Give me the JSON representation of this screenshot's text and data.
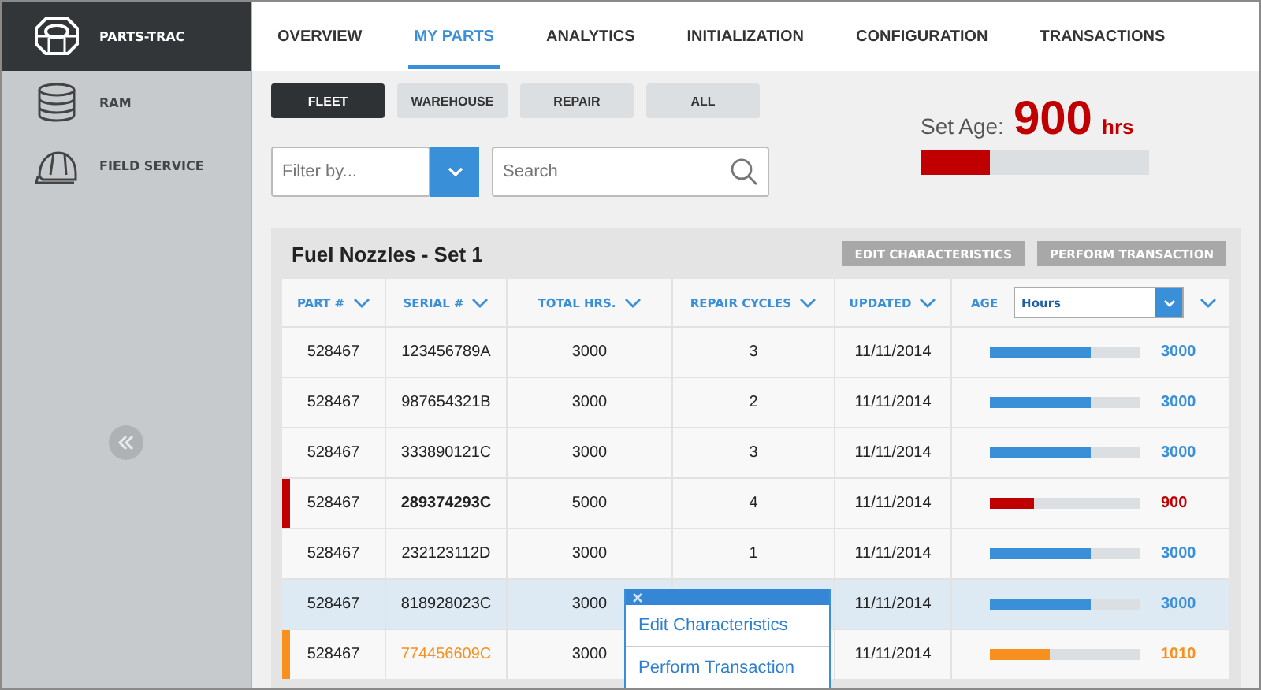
{
  "sidebar": {
    "items": [
      {
        "label": "PARTS-TRAC",
        "selected": true
      },
      {
        "label": "RAM",
        "selected": false
      },
      {
        "label": "FIELD SERVICE",
        "selected": false
      }
    ]
  },
  "tabs": [
    {
      "label": "OVERVIEW",
      "selected": false
    },
    {
      "label": "MY PARTS",
      "selected": true
    },
    {
      "label": "ANALYTICS",
      "selected": false
    },
    {
      "label": "INITIALIZATION",
      "selected": false
    },
    {
      "label": "CONFIGURATION",
      "selected": false
    },
    {
      "label": "TRANSACTIONS",
      "selected": false
    }
  ],
  "filters": [
    {
      "label": "FLEET",
      "selected": true
    },
    {
      "label": "WAREHOUSE",
      "selected": false
    },
    {
      "label": "REPAIR",
      "selected": false
    },
    {
      "label": "ALL",
      "selected": false
    }
  ],
  "filter_select": {
    "placeholder": "Filter by..."
  },
  "search": {
    "placeholder": "Search"
  },
  "set_age": {
    "label": "Set Age:",
    "value": "900",
    "unit": "hrs",
    "level": 0.3
  },
  "card": {
    "title": "Fuel Nozzles - Set 1",
    "actions": [
      "EDIT CHARACTERISTICS",
      "PERFORM TRANSACTION"
    ]
  },
  "table": {
    "columns": [
      "PART #",
      "SERIAL #",
      "TOTAL HRS.",
      "REPAIR CYCLES",
      "UPDATED",
      "AGE"
    ],
    "age_select": {
      "value": "Hours"
    },
    "rows": [
      {
        "part": "528467",
        "serial": "123456789A",
        "total": "3000",
        "cycles": "3",
        "updated": "11/11/2014",
        "level": 0.68,
        "reading": "3000",
        "kind": "normal",
        "color": "#3a8fd9",
        "selected": false
      },
      {
        "part": "528467",
        "serial": "987654321B",
        "total": "3000",
        "cycles": "2",
        "updated": "11/11/2014",
        "level": 0.68,
        "reading": "3000",
        "kind": "normal",
        "color": "#3a8fd9",
        "selected": false
      },
      {
        "part": "528467",
        "serial": "333890121C",
        "total": "3000",
        "cycles": "3",
        "updated": "11/11/2014",
        "level": 0.68,
        "reading": "3000",
        "kind": "normal",
        "color": "#3a8fd9",
        "selected": false
      },
      {
        "part": "528467",
        "serial": "289374293C",
        "total": "5000",
        "cycles": "4",
        "updated": "11/11/2014",
        "level": 0.3,
        "reading": "900",
        "kind": "critical",
        "color": "#c00000",
        "selected": false
      },
      {
        "part": "528467",
        "serial": "232123112D",
        "total": "3000",
        "cycles": "1",
        "updated": "11/11/2014",
        "level": 0.68,
        "reading": "3000",
        "kind": "normal",
        "color": "#3a8fd9",
        "selected": false
      },
      {
        "part": "528467",
        "serial": "818928023C",
        "total": "3000",
        "cycles": "",
        "updated": "11/11/2014",
        "level": 0.68,
        "reading": "3000",
        "kind": "normal",
        "color": "#3a8fd9",
        "selected": true
      },
      {
        "part": "528467",
        "serial": "774456609C",
        "total": "3000",
        "cycles": "",
        "updated": "11/11/2014",
        "level": 0.41,
        "reading": "1010",
        "kind": "warning",
        "color": "#f7901e",
        "selected": false
      }
    ]
  },
  "context_menu": {
    "items": [
      "Edit Characteristics",
      "Perform Transaction"
    ]
  }
}
